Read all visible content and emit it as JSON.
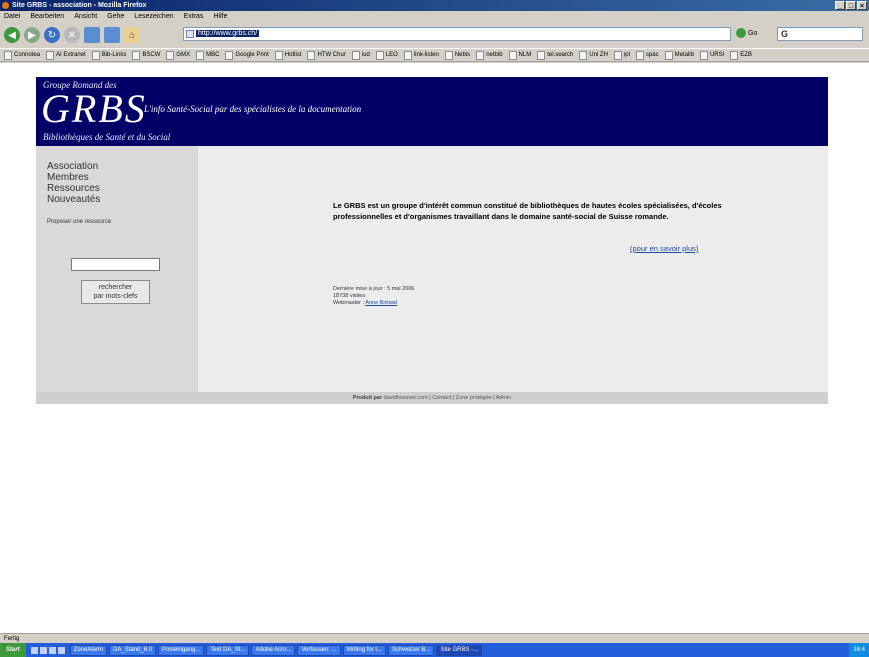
{
  "window": {
    "title": "Site GRBS - association - Mozilla Firefox",
    "controls": [
      "_",
      "□",
      "×"
    ]
  },
  "menu": [
    "Datei",
    "Bearbeiten",
    "Ansicht",
    "Gehe",
    "Lesezeichen",
    "Extras",
    "Hilfe"
  ],
  "navbar": {
    "url": "http://www.grbs.ch/",
    "go_label": "Go",
    "search_value": "G"
  },
  "bookmarks": [
    "Connotea",
    "AI Extranet",
    "Bib-Links",
    "BSCW",
    "GMX",
    "MBC",
    "Google Print",
    "Hotlist",
    "HTW Chur",
    "iud",
    "LEO",
    "link-listen",
    "Nebis",
    "netbib",
    "NLM",
    "tel.search",
    "Uni ZH",
    "ipl",
    "spac",
    "Metalib",
    "URSI",
    "EZB"
  ],
  "site": {
    "banner": {
      "top": "Groupe Romand des",
      "logo": "GRBS",
      "tagline": "L'info Santé-Social par des spécialistes de la documentation",
      "bottom": "Bibliothèques de Santé et du Social"
    },
    "nav": [
      "Association",
      "Membres",
      "Ressources",
      "Nouveautés"
    ],
    "propose": "Proposer une ressource",
    "search_button": "rechercher\npar mots-clefs",
    "intro": "Le GRBS est un groupe d'intérêt commun constitué de bibliothèques de hautes écoles spécialisées, d'écoles professionnelles et d'organismes travaillant dans le domaine santé-social de Suisse romande.",
    "more_link": "(pour en savoir plus)",
    "meta": {
      "updated": "Dernière mise à jour : 5 mai 2006",
      "visits": "18738 visites",
      "webmaster_label": "Webmaster :",
      "webmaster_name": "Anne Brésad"
    },
    "footer": {
      "produced_by": "Produit par",
      "producer": "davidhossvet.com",
      "links": [
        "Contact",
        "Zone protégée",
        "Admin"
      ]
    }
  },
  "status": "Fertig",
  "taskbar": {
    "start": "Start",
    "tasks": [
      "ZoneAlarm",
      "DA_Stand_6.0",
      "Posteingang...",
      "Text DA_St...",
      "Adobe Acro...",
      "Verfassen: ...",
      "Writing for t...",
      "Schweizer B...",
      "Site GRBS -..."
    ],
    "clock": "16:4"
  }
}
